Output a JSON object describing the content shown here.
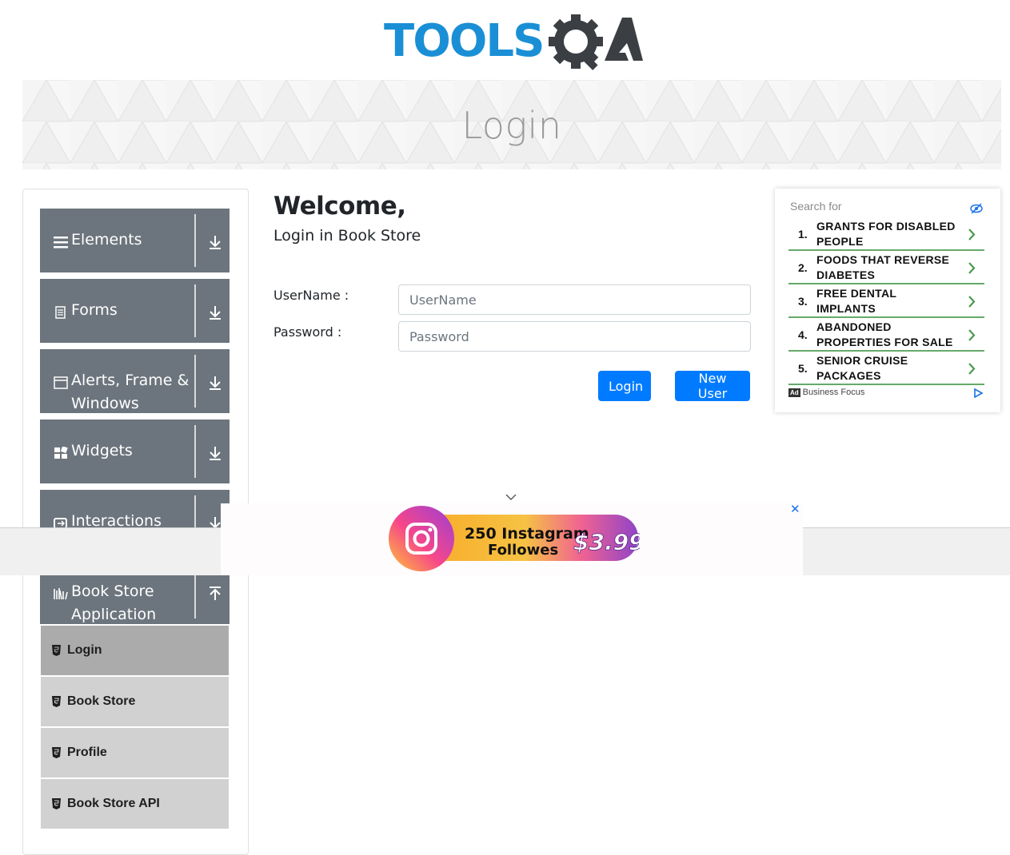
{
  "brand": {
    "name": "TOOLSQA"
  },
  "banner": {
    "title": "Login"
  },
  "sidebar": {
    "groups": [
      {
        "label": "Elements",
        "icon": "hamburger-icon",
        "state": "collapsed"
      },
      {
        "label": "Forms",
        "icon": "document-icon",
        "state": "collapsed"
      },
      {
        "label": "Alerts, Frame & Windows",
        "icon": "window-icon",
        "state": "collapsed"
      },
      {
        "label": "Widgets",
        "icon": "widgets-icon",
        "state": "collapsed"
      },
      {
        "label": "Interactions",
        "icon": "interactions-icon",
        "state": "collapsed"
      },
      {
        "label": "Book Store Application",
        "icon": "books-icon",
        "state": "expanded"
      }
    ],
    "book_store_items": [
      {
        "label": "Login",
        "active": true
      },
      {
        "label": "Book Store",
        "active": false
      },
      {
        "label": "Profile",
        "active": false
      },
      {
        "label": "Book Store API",
        "active": false
      }
    ]
  },
  "main": {
    "welcome": "Welcome,",
    "subtitle": "Login in Book Store",
    "username_label": "UserName :",
    "username_placeholder": "UserName",
    "password_label": "Password :",
    "password_placeholder": "Password",
    "login_button": "Login",
    "new_user_button": "New User"
  },
  "ad": {
    "search_for": "Search for",
    "items": [
      {
        "num": "1.",
        "text": "GRANTS FOR DISABLED PEOPLE"
      },
      {
        "num": "2.",
        "text": "FOODS THAT REVERSE DIABETES"
      },
      {
        "num": "3.",
        "text": "FREE DENTAL IMPLANTS"
      },
      {
        "num": "4.",
        "text": "ABANDONED PROPERTIES FOR SALE"
      },
      {
        "num": "5.",
        "text": "SENIOR CRUISE PACKAGES"
      }
    ],
    "badge": "Ad",
    "provider": "Business Focus"
  },
  "popup_ad": {
    "line1": "250 Instagram",
    "line2": "Followes",
    "price": "$3.99",
    "close": "✕"
  },
  "colors": {
    "sidebar_group_bg": "#6c757d",
    "sub_item_bg": "#d1d1d1",
    "sub_item_active_bg": "#ababab",
    "primary_button": "#007bff",
    "logo_blue": "#1a8fd6",
    "ad_divider": "#66a96a"
  }
}
